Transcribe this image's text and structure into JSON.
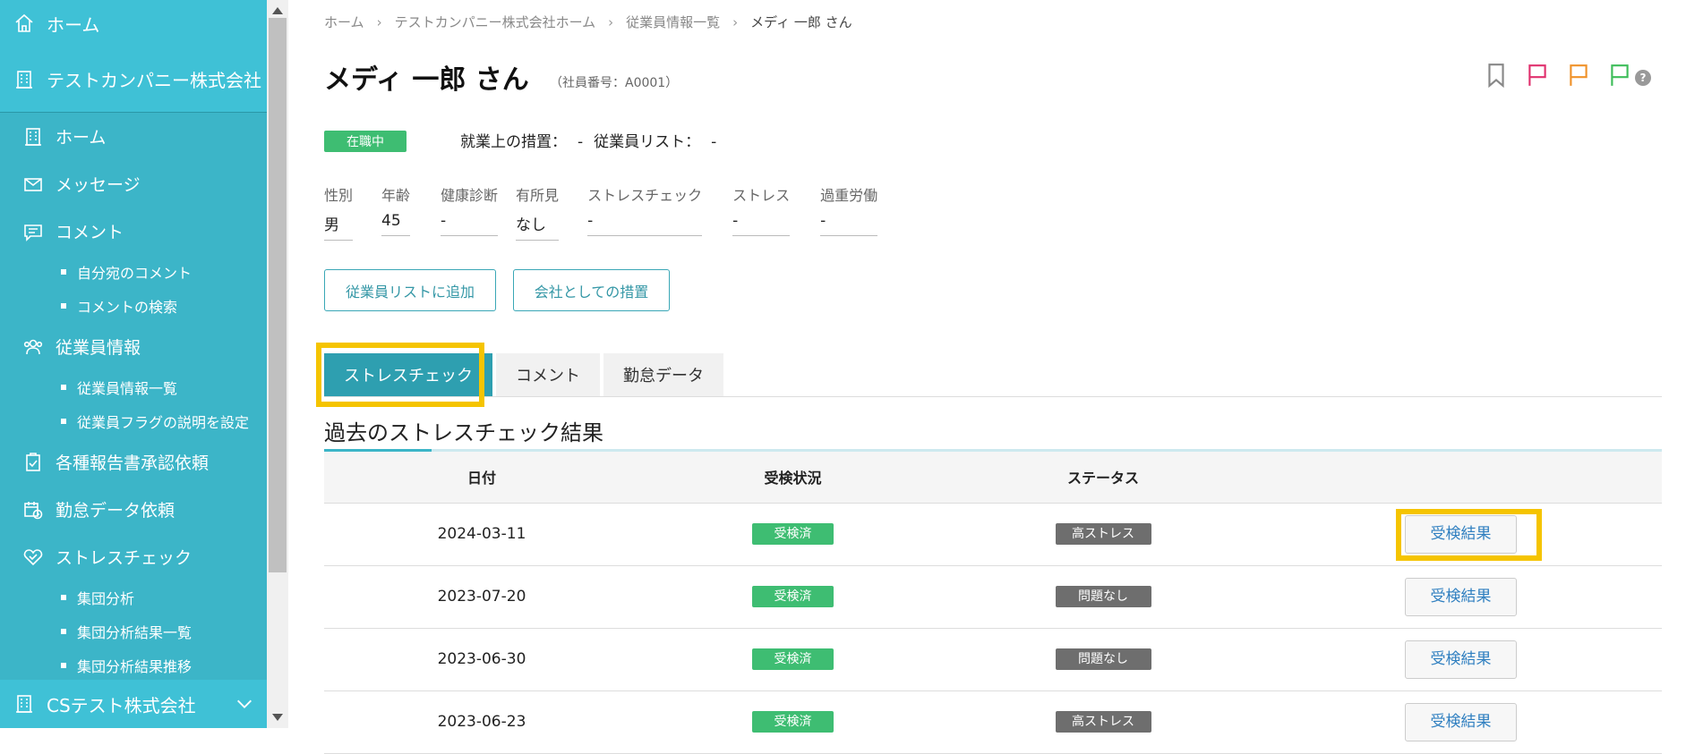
{
  "sidebar": {
    "top_home": "ホーム",
    "company": "テストカンパニー株式会社",
    "menu": {
      "home": "ホーム",
      "message": "メッセージ",
      "comment": "コメント",
      "comment_sub": [
        "自分宛のコメント",
        "コメントの検索"
      ],
      "employee": "従業員情報",
      "employee_sub": [
        "従業員情報一覧",
        "従業員フラグの説明を設定"
      ],
      "reports": "各種報告書承認依頼",
      "attendance": "勤怠データ依頼",
      "stress": "ストレスチェック",
      "stress_sub": [
        "集団分析",
        "集団分析結果一覧",
        "集団分析結果推移"
      ]
    },
    "bottom_company": "CSテスト株式会社"
  },
  "breadcrumb": [
    "ホーム",
    "テストカンパニー株式会社ホーム",
    "従業員情報一覧",
    "メディ 一郎 さん"
  ],
  "header": {
    "title": "メディ 一郎 さん",
    "employee_no": "（社員番号：A0001）",
    "colors": {
      "bookmark": "#888888",
      "flag1": "#e0316e",
      "flag2": "#f0922a",
      "flag3": "#3ebd5a"
    },
    "help": "?"
  },
  "status": {
    "badge": "在職中",
    "measure_label": "就業上の措置：",
    "measure_value": "-",
    "list_label": "従業員リスト：",
    "list_value": "-"
  },
  "attributes": [
    {
      "key": "性別",
      "value": "男"
    },
    {
      "key": "年齢",
      "value": "45"
    },
    {
      "key": "健康診断",
      "value": "-"
    },
    {
      "key": "有所見",
      "value": "なし"
    },
    {
      "key": "ストレスチェック",
      "value": "-"
    },
    {
      "key": "ストレス",
      "value": "-"
    },
    {
      "key": "過重労働",
      "value": "-"
    }
  ],
  "buttons": {
    "add_to_list": "従業員リストに追加",
    "company_measure": "会社としての措置"
  },
  "tabs": [
    "ストレスチェック",
    "コメント",
    "勤怠データ"
  ],
  "section_title": "過去のストレスチェック結果",
  "table": {
    "headers": [
      "日付",
      "受検状況",
      "ステータス",
      ""
    ],
    "rows": [
      {
        "date": "2024-03-11",
        "exam": "受検済",
        "status": "高ストレス",
        "action": "受検結果"
      },
      {
        "date": "2023-07-20",
        "exam": "受検済",
        "status": "問題なし",
        "action": "受検結果"
      },
      {
        "date": "2023-06-30",
        "exam": "受検済",
        "status": "問題なし",
        "action": "受検結果"
      },
      {
        "date": "2023-06-23",
        "exam": "受検済",
        "status": "高ストレス",
        "action": "受検結果"
      }
    ]
  },
  "highlight_color": "#f5c400"
}
